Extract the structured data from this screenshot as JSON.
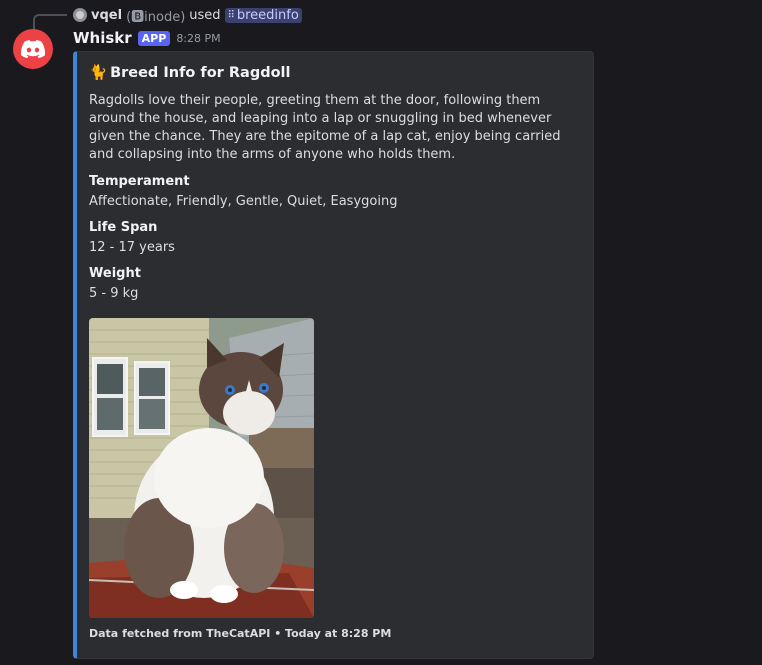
{
  "reply": {
    "username": "vqel",
    "handle": "(🅱inode)",
    "used_text": "used",
    "command": "breedinfo"
  },
  "message": {
    "bot_name": "Whiskr",
    "badge": "APP",
    "time": "8:28 PM"
  },
  "embed": {
    "title_emoji": "🐈",
    "title": "Breed Info for Ragdoll",
    "description": "Ragdolls love their people, greeting them at the door, following them around the house, and leaping into a lap or snuggling in bed whenever given the chance. They are the epitome of a lap cat, enjoy being carried and collapsing into the arms of anyone who holds them.",
    "fields": [
      {
        "name": "Temperament",
        "value": "Affectionate, Friendly, Gentle, Quiet, Easygoing"
      },
      {
        "name": "Life Span",
        "value": "12 - 17 years"
      },
      {
        "name": "Weight",
        "value": "5 - 9 kg"
      }
    ],
    "footer": "Data fetched from TheCatAPI • Today at 8:28 PM",
    "accent_color": "#3f86d8"
  },
  "colors": {
    "background": "#1a1a1e",
    "avatar": "#ed4245",
    "badge": "#5865f2"
  }
}
